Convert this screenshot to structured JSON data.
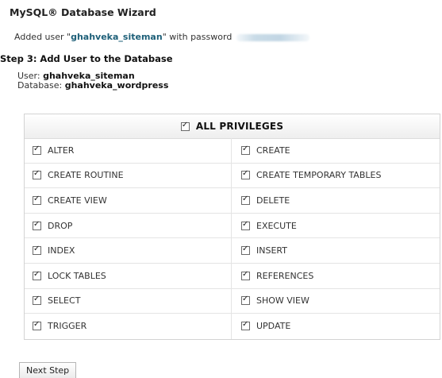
{
  "page": {
    "title": "MySQL® Database Wizard",
    "added_prefix": "Added user \"",
    "added_user": "ghahveka_siteman",
    "added_suffix": "\" with password",
    "step": "Step 3: Add User to the Database",
    "user_label": "User:",
    "user_value": "ghahveka_siteman",
    "db_label": "Database:",
    "db_value": "ghahveka_wordpress"
  },
  "privileges": {
    "all_label": "ALL PRIVILEGES",
    "all_checked": true,
    "items": [
      {
        "left": "ALTER",
        "right": "CREATE"
      },
      {
        "left": "CREATE ROUTINE",
        "right": "CREATE TEMPORARY TABLES"
      },
      {
        "left": "CREATE VIEW",
        "right": "DELETE"
      },
      {
        "left": "DROP",
        "right": "EXECUTE"
      },
      {
        "left": "INDEX",
        "right": "INSERT"
      },
      {
        "left": "LOCK TABLES",
        "right": "REFERENCES"
      },
      {
        "left": "SELECT",
        "right": "SHOW VIEW"
      },
      {
        "left": "TRIGGER",
        "right": "UPDATE"
      }
    ]
  },
  "buttons": {
    "next": "Next Step"
  }
}
